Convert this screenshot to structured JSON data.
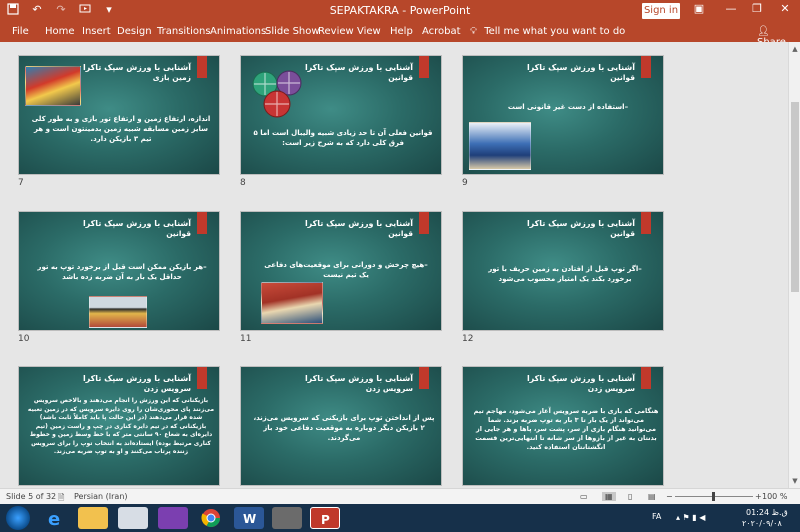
{
  "titlebar": {
    "title": "SEPAKTAKRA  -  PowerPoint",
    "signin": "Sign in"
  },
  "ribbon": {
    "tabs": [
      "File",
      "Home",
      "Insert",
      "Design",
      "Transitions",
      "Animations",
      "Slide Show",
      "Review",
      "View",
      "Help",
      "Acrobat"
    ],
    "tellme": "Tell me what you want to do",
    "share": "Share"
  },
  "slides": [
    {
      "num": "7",
      "title": "آشنایی با ورزش سپک تاکرا",
      "sub": "زمین بازی",
      "body": "اندازه، ارتفاع زمین و ارتفاع تور بازی و به طور کلی سایز زمین مسابقه شبیه زمین بدمینتون است و هر تیم ۳ بازیکن دارد."
    },
    {
      "num": "8",
      "title": "آشنایی با ورزش سپک تاکرا",
      "sub": "قوانین",
      "body": "قوانین فعلی آن تا حد زیادی شبیه والیبال است اما ۵ فرق کلی دارد که به شرح زیر است:"
    },
    {
      "num": "9",
      "title": "آشنایی با ورزش سپک تاکرا",
      "sub": "قوانین",
      "body": "–استفاده از دست غیر قانونی است"
    },
    {
      "num": "10",
      "title": "آشنایی با ورزش سپک تاکرا",
      "sub": "قوانین",
      "body": "–هر بازیکن ممکن است قبل از برخورد توپ به تور حداقل یک بار به آن ضربه زده باشد"
    },
    {
      "num": "11",
      "title": "آشنایی با ورزش سپک تاکرا",
      "sub": "قوانین",
      "body": "–هیچ چرخش و دورانی برای موقعیت‌های دفاعی یک تیم نیست"
    },
    {
      "num": "12",
      "title": "آشنایی با ورزش سپک تاکرا",
      "sub": "قوانین",
      "body": "–اگر توپ قبل از افتادن به زمین حریف با تور برخورد بکند یک امتیاز محسوب می‌شود"
    },
    {
      "num": "13",
      "title": "آشنایی با ورزش سپک تاکرا",
      "sub": "سرویس زدن",
      "body": "بازیکنانی که این ورزش را انجام می‌دهند و بالاخص سرویس می‌زنند پای محوری‌شان را روی دایره سرویس که در زمین تعبیه شده قرار می‌دهند (در این حالت پا باید کاملاً ثابت باشد) بازیکنانی که در تیم دایره کناری در چپ و راست زمین (تیم دایره‌ای به شعاع ۹۰ سانتی متر که با خط وسط زمین و خطوط کناری مرتبط بوده) ایستاده‌اند به انتخاب توپ را برای سرویس زننده پرتاب می‌کنند و او به توپ ضربه می‌زند."
    },
    {
      "num": "14",
      "title": "آشنایی با ورزش سپک تاکرا",
      "sub": "سرویس زدن",
      "body": "پس از انداختن توپ برای بازیکنی که سرویس می‌زند، ۲ بازیکن دیگر دوباره به موقعیت دفاعی خود باز می‌گردند."
    },
    {
      "num": "15",
      "title": "آشنایی با ورزش سپک تاکرا",
      "sub": "سرویس زدن",
      "body": "هنگامی که بازی با ضربه سرویس آغاز می‌شود، مهاجم تیم می‌تواند از یک بار تا ۳ بار به توپ ضربه بزند. شما می‌توانید هنگام بازی از سر، پشت سر، پاها و هر جایی از بدنتان به غیر از بازوها از سر شانه تا انتهایی‌ترین قسمت انگشتانتان استفاده کنید."
    }
  ],
  "status": {
    "slide": "Slide 5 of 32",
    "lang": "Persian (Iran)",
    "zoom": "100 %",
    "zoom_level": 1.0
  },
  "taskbar": {
    "lang": "FA",
    "time": "01:24 ق.ظ",
    "date": "۲۰۲۰/۰۹/۰۸"
  }
}
